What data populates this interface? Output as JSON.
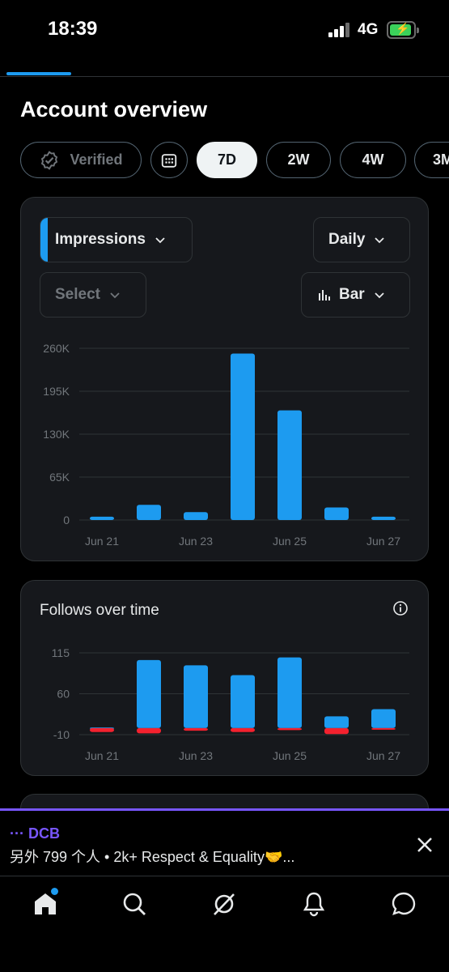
{
  "status": {
    "time": "18:39",
    "network": "4G"
  },
  "page": {
    "title": "Account overview"
  },
  "chips": [
    {
      "label": "Verified",
      "icon": "verified-check-icon"
    },
    {
      "label": "",
      "icon": "calendar-icon"
    },
    {
      "label": "7D",
      "active": true
    },
    {
      "label": "2W"
    },
    {
      "label": "4W"
    },
    {
      "label": "3M"
    }
  ],
  "impressions_card": {
    "metric_select": "Impressions",
    "interval_select": "Daily",
    "compare_select": "Select",
    "chart_type_select": "Bar"
  },
  "follows_card": {
    "title": "Follows over time"
  },
  "banner": {
    "title": "··· DCB",
    "subtitle": "另外 799 个人 • 2k+ Respect & Equality🤝..."
  },
  "nav": [
    "home-icon",
    "search-icon",
    "grok-icon",
    "notifications-icon",
    "messages-icon"
  ],
  "colors": {
    "accent": "#1d9bf0",
    "negative": "#f4212e",
    "banner_accent": "#7856ff"
  },
  "chart_data": [
    {
      "type": "bar",
      "title": "",
      "x_ticks": [
        "Jun 21",
        "Jun 23",
        "Jun 25",
        "Jun 27"
      ],
      "y_ticks": [
        "260K",
        "195K",
        "130K",
        "65K",
        "0"
      ],
      "categories": [
        "Jun 21",
        "Jun 22",
        "Jun 23",
        "Jun 24",
        "Jun 25",
        "Jun 26",
        "Jun 27"
      ],
      "series": [
        {
          "values": [
            5000,
            23000,
            12000,
            252000,
            166000,
            19000,
            5000
          ]
        }
      ],
      "ylim": [
        0,
        260000
      ],
      "grid": true
    },
    {
      "type": "bar",
      "title": "Follows over time",
      "x_ticks": [
        "Jun 21",
        "Jun 23",
        "Jun 25",
        "Jun 27"
      ],
      "y_ticks": [
        "115",
        "60",
        "-10"
      ],
      "categories": [
        "Jun 21",
        "Jun 22",
        "Jun 23",
        "Jun 24",
        "Jun 25",
        "Jun 26",
        "Jun 27"
      ],
      "series": [
        {
          "values": [
            1,
            104,
            96,
            81,
            108,
            18,
            29
          ]
        },
        {
          "values": [
            -6,
            -8,
            -4,
            -6,
            -3,
            -9,
            -2
          ]
        }
      ],
      "ylim": [
        -10,
        115
      ],
      "grid": true
    }
  ]
}
